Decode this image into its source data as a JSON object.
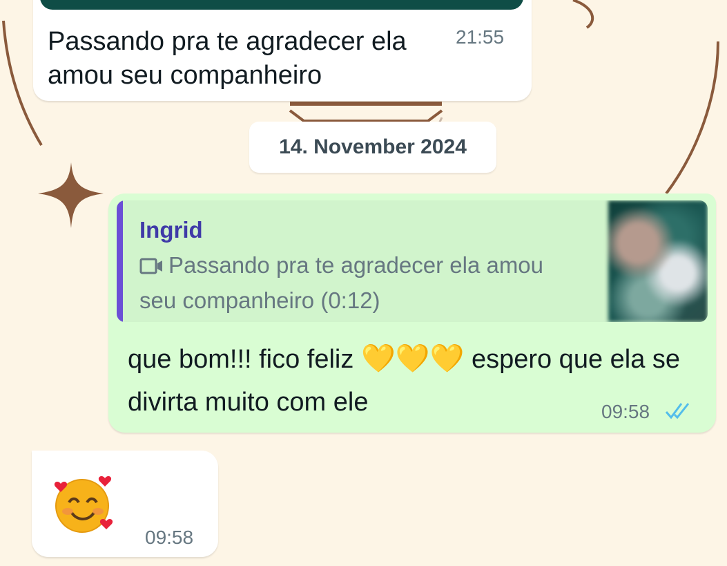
{
  "messages": {
    "first": {
      "text": "Passando pra te agradecer ela amou seu companheiro",
      "time": "21:55"
    },
    "date_separator": "14. November 2024",
    "reply": {
      "quote_author": "Ingrid",
      "quote_icon": "video-camera-icon",
      "quote_text": "Passando pra te agradecer ela amou seu companheiro (0:12)",
      "text_part1": "que bom!!! fico feliz",
      "emoji": "💛💛💛",
      "text_part2": "espero que ela se divirta muito com ele",
      "time": "09:58",
      "status": "read-double-check"
    },
    "incoming_emoji": {
      "emoji": "🥰",
      "time": "09:58"
    }
  },
  "colors": {
    "background": "#fdf5e6",
    "incoming_bubble": "#ffffff",
    "outgoing_bubble": "#d9fdd3",
    "quote_accent": "#6b4fd6",
    "read_tick": "#53bdeb"
  }
}
